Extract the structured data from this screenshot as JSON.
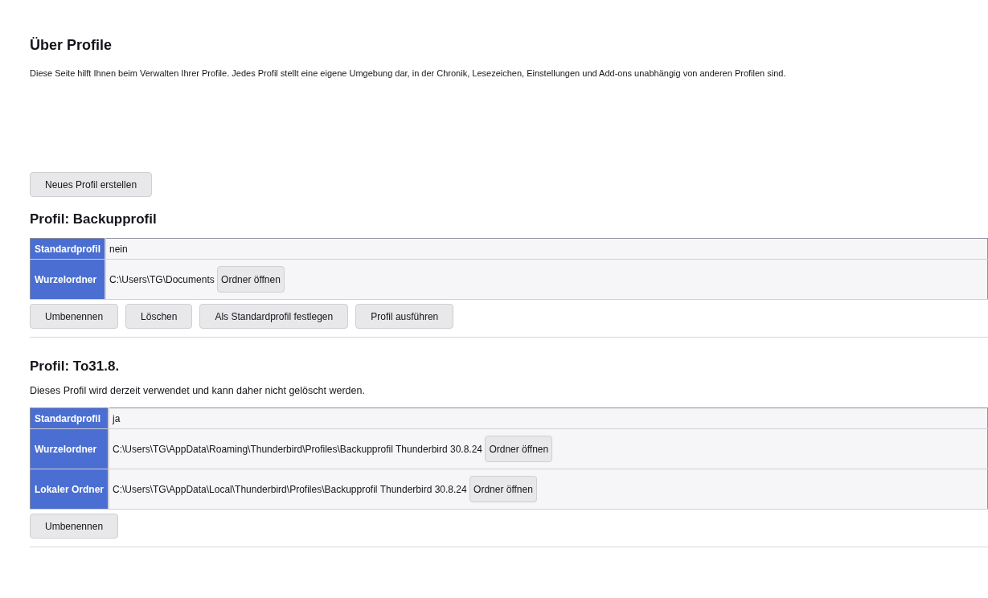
{
  "title": "Über Profile",
  "description": "Diese Seite hilft Ihnen beim Verwalten Ihrer Profile. Jedes Profil stellt eine eigene Umgebung dar, in der Chronik, Lesezeichen, Einstellungen und Add-ons unabhängig von anderen Profilen sind.",
  "new_profile_button": "Neues Profil erstellen",
  "profiles": [
    {
      "heading": "Profil: Backupprofil",
      "rows": [
        {
          "label": "Standardprofil",
          "value": "nein"
        },
        {
          "label": "Wurzelordner",
          "value": "C:\\Users\\TG\\Documents",
          "button": "Ordner öffnen"
        }
      ],
      "buttons": [
        "Umbenennen",
        "Löschen",
        "Als Standardprofil festlegen",
        "Profil ausführen"
      ]
    },
    {
      "heading": "Profil: To31.8.",
      "note": "Dieses Profil wird derzeit verwendet und kann daher nicht gelöscht werden.",
      "rows": [
        {
          "label": "Standardprofil",
          "value": "ja"
        },
        {
          "label": "Wurzelordner",
          "value": "C:\\Users\\TG\\AppData\\Roaming\\Thunderbird\\Profiles\\Backupprofil Thunderbird 30.8.24",
          "button": "Ordner öffnen"
        },
        {
          "label": "Lokaler Ordner",
          "value": "C:\\Users\\TG\\AppData\\Local\\Thunderbird\\Profiles\\Backupprofil Thunderbird 30.8.24",
          "button": "Ordner öffnen"
        }
      ],
      "buttons": [
        "Umbenennen"
      ]
    }
  ]
}
